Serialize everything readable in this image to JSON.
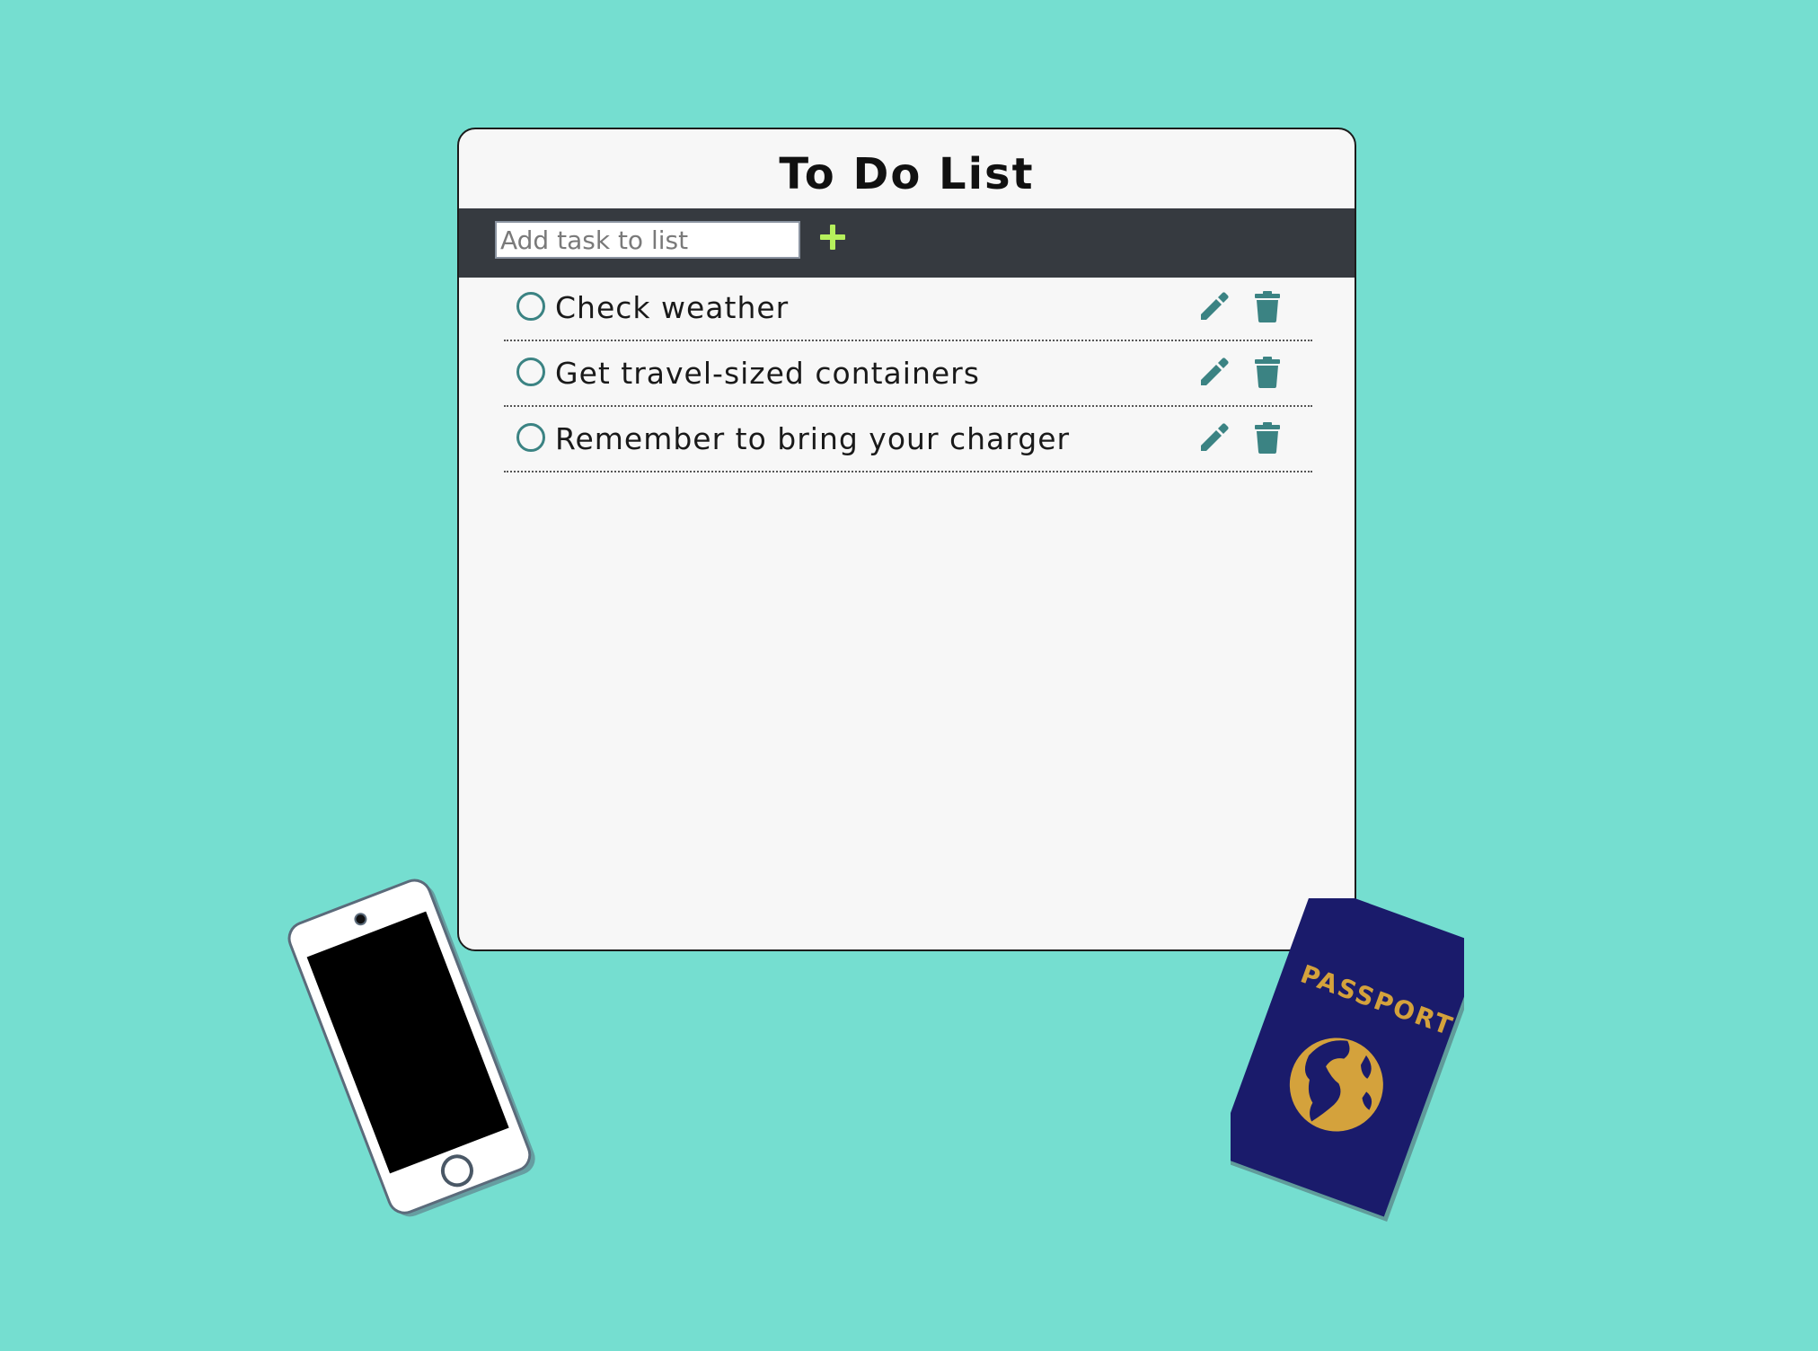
{
  "background_color": "#75ded0",
  "todo": {
    "title": "To Do List",
    "add_input": {
      "placeholder": "Add task to list",
      "value": ""
    },
    "add_button_icon": "plus-icon",
    "add_button_color": "#b6f05c",
    "tasks": [
      {
        "label": "Check weather",
        "completed": false
      },
      {
        "label": "Get travel-sized containers",
        "completed": false
      },
      {
        "label": "Remember to bring your charger",
        "completed": false
      }
    ],
    "task_icons": {
      "check": "circle-icon",
      "edit": "pencil-icon",
      "delete": "trash-icon"
    },
    "icon_color": "#3b8383",
    "bar_color": "#363a40"
  },
  "decorations": {
    "phone": {
      "icon": "smartphone-icon"
    },
    "passport": {
      "icon": "passport-icon",
      "label": "PASSPORT",
      "cover_color": "#1a1b6b",
      "accent_color": "#d4a23c"
    }
  }
}
